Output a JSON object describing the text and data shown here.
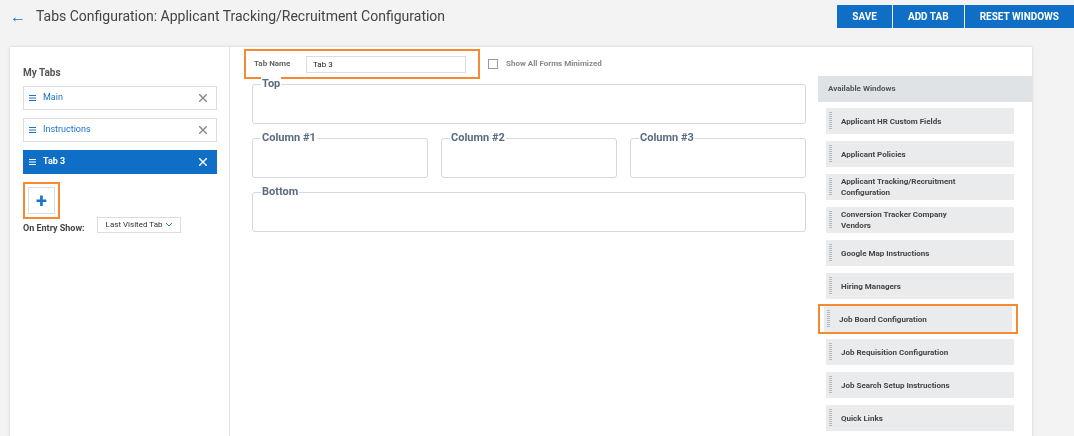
{
  "header": {
    "back": "←",
    "title": "Tabs Configuration: Applicant Tracking/Recruitment Configuration",
    "buttons": [
      "SAVE",
      "ADD TAB",
      "RESET WINDOWS"
    ]
  },
  "my_tabs": {
    "title": "My Tabs",
    "items": [
      {
        "label": "Main",
        "selected": false
      },
      {
        "label": "Instructions",
        "selected": false
      },
      {
        "label": "Tab 3",
        "selected": true
      }
    ],
    "add_button": {
      "label": "+",
      "highlighted": true
    },
    "on_entry": {
      "label": "On Entry Show:",
      "value": "Last Visited Tab"
    }
  },
  "tab_editor": {
    "tab_name": {
      "label": "Tab Name",
      "value": "Tab 3",
      "highlighted": true
    },
    "show_minimized": {
      "label": "Show All Forms Minimized",
      "checked": false
    },
    "zones": {
      "top": "Top",
      "columns": [
        "Column #1",
        "Column #2",
        "Column #3"
      ],
      "bottom": "Bottom"
    }
  },
  "available_windows": {
    "title": "Available Windows",
    "items": [
      {
        "label": "Applicant HR Custom Fields",
        "highlighted": false
      },
      {
        "label": "Applicant Policies",
        "highlighted": false
      },
      {
        "label": "Applicant Tracking/Recruitment Configuration",
        "highlighted": false
      },
      {
        "label": "Conversion Tracker Company Vendors",
        "highlighted": false
      },
      {
        "label": "Google Map Instructions",
        "highlighted": false
      },
      {
        "label": "Hiring Managers",
        "highlighted": false
      },
      {
        "label": "Job Board Configuration",
        "highlighted": true
      },
      {
        "label": "Job Requisition Configuration",
        "highlighted": false
      },
      {
        "label": "Job Search Setup Instructions",
        "highlighted": false
      },
      {
        "label": "Quick Links",
        "highlighted": false
      }
    ]
  }
}
